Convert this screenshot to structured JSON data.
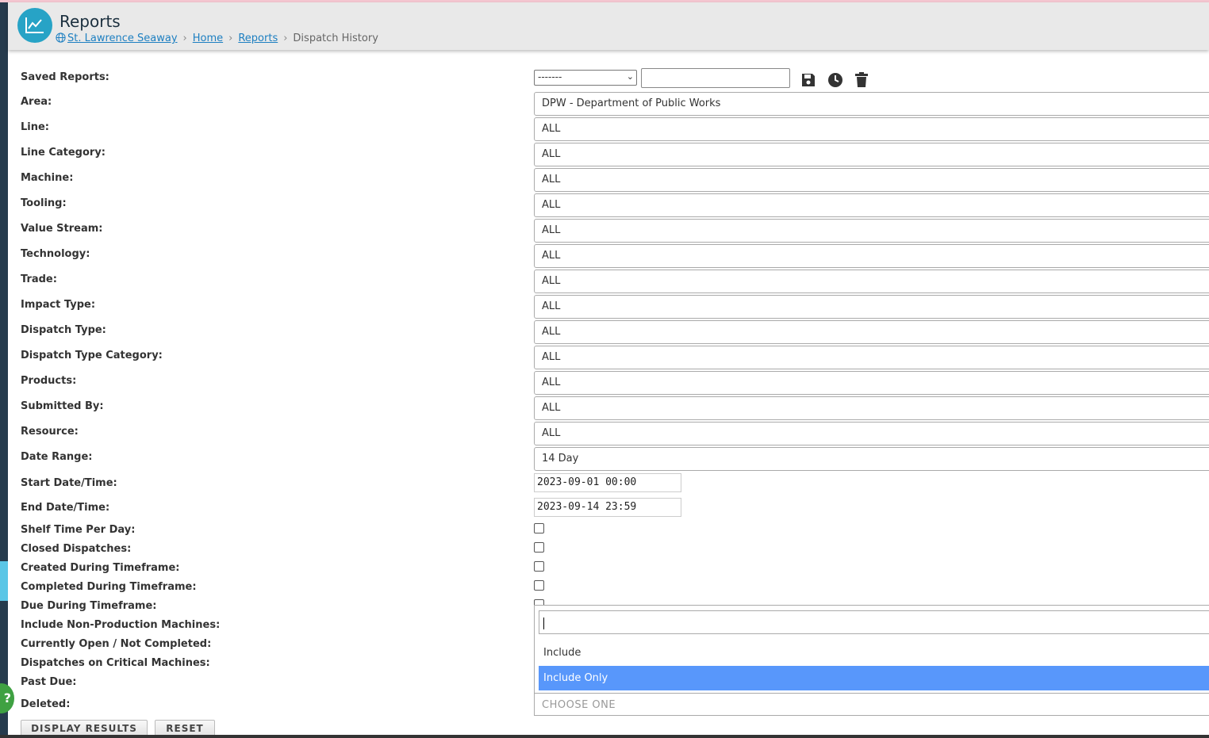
{
  "header": {
    "title": "Reports",
    "breadcrumb": {
      "site": "St. Lawrence Seaway",
      "home": "Home",
      "reports": "Reports",
      "current": "Dispatch History"
    }
  },
  "saved_reports": {
    "label": "Saved Reports:",
    "selected": "-------",
    "name_value": "",
    "icons": [
      "save-icon",
      "clock-icon",
      "trash-icon"
    ]
  },
  "filters": {
    "area": {
      "label": "Area:",
      "value": "DPW - Department of Public Works"
    },
    "line": {
      "label": "Line:",
      "value": "ALL"
    },
    "line_category": {
      "label": "Line Category:",
      "value": "ALL"
    },
    "machine": {
      "label": "Machine:",
      "value": "ALL"
    },
    "tooling": {
      "label": "Tooling:",
      "value": "ALL"
    },
    "value_stream": {
      "label": "Value Stream:",
      "value": "ALL"
    },
    "technology": {
      "label": "Technology:",
      "value": "ALL"
    },
    "trade": {
      "label": "Trade:",
      "value": "ALL"
    },
    "impact_type": {
      "label": "Impact Type:",
      "value": "ALL"
    },
    "dispatch_type": {
      "label": "Dispatch Type:",
      "value": "ALL"
    },
    "dispatch_type_category": {
      "label": "Dispatch Type Category:",
      "value": "ALL"
    },
    "products": {
      "label": "Products:",
      "value": "ALL"
    },
    "submitted_by": {
      "label": "Submitted By:",
      "value": "ALL"
    },
    "resource": {
      "label": "Resource:",
      "value": "ALL"
    },
    "date_range": {
      "label": "Date Range:",
      "value": "14 Day"
    },
    "start": {
      "label": "Start Date/Time:",
      "value": "2023-09-01 00:00"
    },
    "end": {
      "label": "End Date/Time:",
      "value": "2023-09-14 23:59"
    }
  },
  "options": {
    "shelf_time": {
      "label": "Shelf Time Per Day:",
      "checked": false
    },
    "closed": {
      "label": "Closed Dispatches:",
      "checked": false
    },
    "created": {
      "label": "Created During Timeframe:",
      "checked": false
    },
    "completed": {
      "label": "Completed During Timeframe:",
      "checked": false
    },
    "due": {
      "label": "Due During Timeframe:",
      "checked": false
    },
    "non_production": {
      "label": "Include Non-Production Machines:"
    },
    "currently_open": {
      "label": "Currently Open / Not Completed:"
    },
    "critical": {
      "label": "Dispatches on Critical Machines:"
    },
    "past_due": {
      "label": "Past Due:"
    },
    "deleted": {
      "label": "Deleted:"
    }
  },
  "dropdown": {
    "search_value": "",
    "options": [
      "Include",
      "Include Only"
    ],
    "highlighted": "Include Only",
    "selected": "CHOOSE ONE"
  },
  "buttons": {
    "display": "DISPLAY RESULTS",
    "reset": "RESET"
  },
  "help": {
    "label": "?"
  },
  "colors": {
    "accent": "#27a3c6",
    "link": "#1d7fc1",
    "highlight": "#5897fb",
    "sidebar": "#263b4d"
  }
}
